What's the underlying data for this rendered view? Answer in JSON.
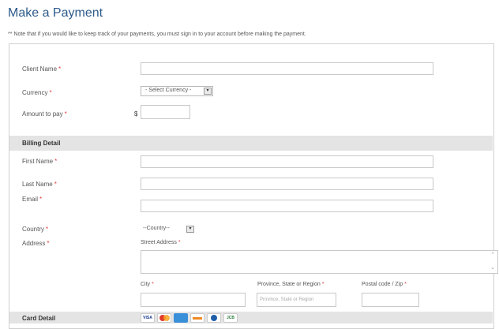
{
  "page": {
    "title": "Make a Payment",
    "note": "** Note that if you would like to keep track of your payments, you must sign in to your account before making the payment."
  },
  "client": {
    "client_name_label": "Client Name",
    "currency_label": "Currency",
    "currency_selected": "- Select Currency -",
    "amount_label": "Amount to pay",
    "currency_symbol": "$",
    "required_mark": "*"
  },
  "billing": {
    "section_title": "Billing Detail",
    "first_name_label": "First Name",
    "last_name_label": "Last Name",
    "email_label": "Email",
    "country_label": "Country",
    "country_selected": "--Country--",
    "address_label": "Address",
    "street_label": "Street Address",
    "city_label": "City",
    "province_label": "Province, State or Region",
    "province_placeholder": "Province, State or Region",
    "postal_label": "Postal code / Zip"
  },
  "card": {
    "section_title": "Card Detail",
    "brands": [
      "visa-icon",
      "mastercard-icon",
      "amex-icon",
      "discover-icon",
      "diners-icon",
      "jcb-icon"
    ],
    "visa_text": "VISA",
    "jcb_text": "JCB"
  },
  "colors": {
    "title": "#2c5a8a",
    "required": "#e04040",
    "section_bg": "#e4e4e4"
  }
}
